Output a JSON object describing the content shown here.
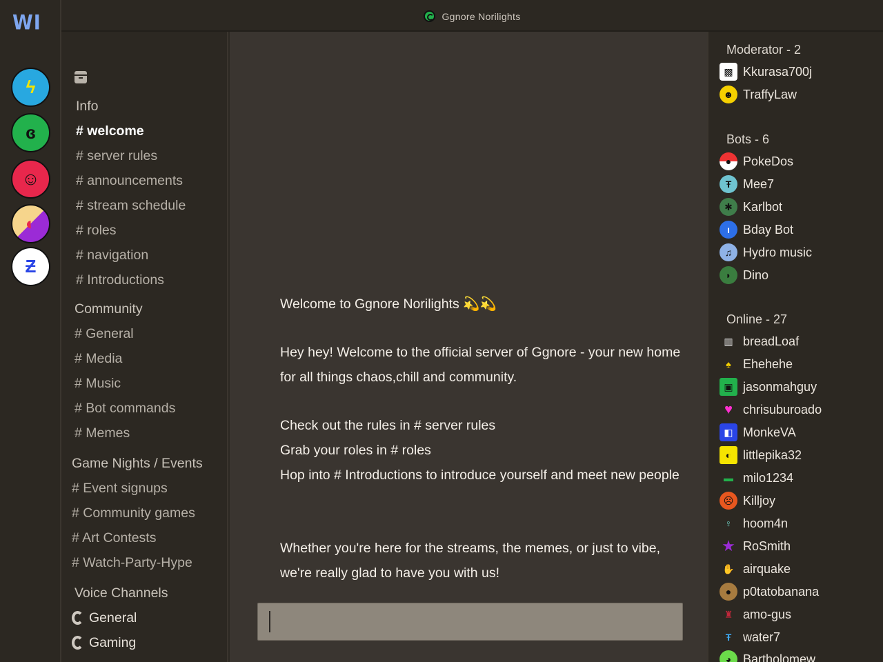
{
  "app": {
    "logo": "WI",
    "server_title": "Ggnore Norilights"
  },
  "servers": [
    {
      "icon": "lightning-icon",
      "glyph": "ϟ",
      "color": "#28a8e0"
    },
    {
      "icon": "spiral-icon",
      "glyph": "ɞ",
      "color": "#22b14c"
    },
    {
      "icon": "face-icon",
      "glyph": "☺",
      "color": "#e8274c"
    },
    {
      "icon": "flame-icon",
      "glyph": "◐",
      "color": "#9b2bd6"
    },
    {
      "icon": "z-icon",
      "glyph": "Ƶ",
      "color": "#ffffff"
    }
  ],
  "sidebar": {
    "categories": {
      "info": "Info",
      "community": "Community",
      "events": "Game Nights / Events",
      "voice": "Voice Channels"
    },
    "info_channels": [
      "# welcome",
      "# server rules",
      "# announcements",
      "# stream schedule",
      "# roles",
      "# navigation",
      "# Introductions"
    ],
    "community_channels": [
      "# General",
      "# Media",
      "# Music",
      "# Bot commands",
      "# Memes"
    ],
    "event_channels": [
      "# Event signups",
      "# Community games",
      "# Art Contests",
      "# Watch-Party-Hype"
    ],
    "voice_channels": [
      "General",
      "Gaming"
    ]
  },
  "chat": {
    "welcome_title": "Welcome to Ggnore Norilights",
    "sparkles": "💫💫",
    "para1": "Hey hey! Welcome to the official server of Ggnore - your new home for all things chaos,chill and community.",
    "line_rules": "Check out the rules in # server rules",
    "line_roles": "Grab your roles in # roles",
    "line_intro": "Hop into # Introductions to introduce yourself and meet new people",
    "para3": "Whether you're here for the streams, the memes, or just to vibe, we're really glad to have you with us!",
    "composer_value": ""
  },
  "members": {
    "moderator_header": "Moderator - 2",
    "moderators": [
      "Kkurasa700j",
      "TraffyLaw"
    ],
    "bots_header": "Bots - 6",
    "bots": [
      "PokeDos",
      "Mee7",
      "Karlbot",
      "Bday Bot",
      "Hydro music",
      "Dino"
    ],
    "online_header": "Online - 27",
    "online": [
      "breadLoaf",
      "Ehehehe",
      "jasonmahguy",
      "chrisuburoado",
      "MonkeVA",
      "littlepika32",
      "milo1234",
      "Killjoy",
      "hoom4n",
      "RoSmith",
      "airquake",
      "p0tatobanana",
      "amo-gus",
      "water7",
      "Bartholomew"
    ]
  },
  "colors": {
    "background": "#2c2822",
    "chat_background": "#3a3530",
    "composer": "#8e877c",
    "logo": "#7ea6ef"
  }
}
